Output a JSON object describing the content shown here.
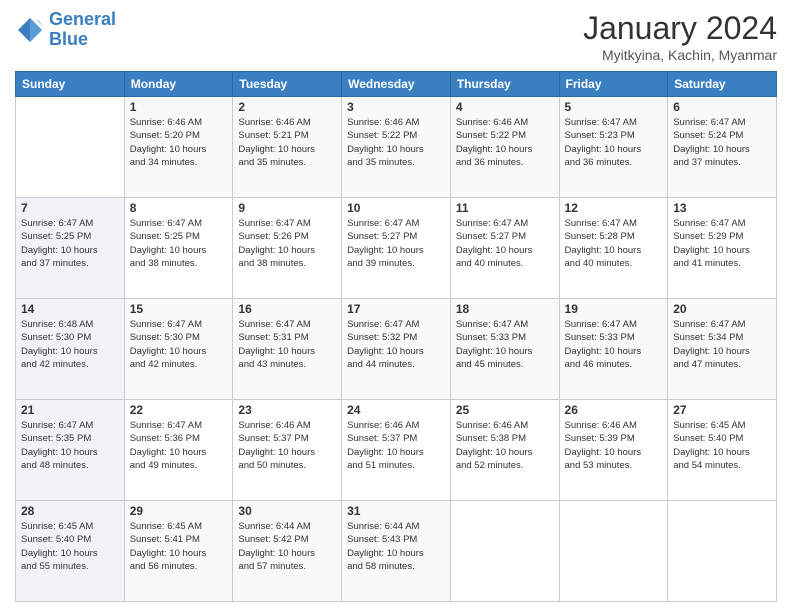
{
  "logo": {
    "line1": "General",
    "line2": "Blue"
  },
  "title": "January 2024",
  "subtitle": "Myitkyina, Kachin, Myanmar",
  "weekdays": [
    "Sunday",
    "Monday",
    "Tuesday",
    "Wednesday",
    "Thursday",
    "Friday",
    "Saturday"
  ],
  "weeks": [
    [
      {
        "day": "",
        "info": ""
      },
      {
        "day": "1",
        "info": "Sunrise: 6:46 AM\nSunset: 5:20 PM\nDaylight: 10 hours\nand 34 minutes."
      },
      {
        "day": "2",
        "info": "Sunrise: 6:46 AM\nSunset: 5:21 PM\nDaylight: 10 hours\nand 35 minutes."
      },
      {
        "day": "3",
        "info": "Sunrise: 6:46 AM\nSunset: 5:22 PM\nDaylight: 10 hours\nand 35 minutes."
      },
      {
        "day": "4",
        "info": "Sunrise: 6:46 AM\nSunset: 5:22 PM\nDaylight: 10 hours\nand 36 minutes."
      },
      {
        "day": "5",
        "info": "Sunrise: 6:47 AM\nSunset: 5:23 PM\nDaylight: 10 hours\nand 36 minutes."
      },
      {
        "day": "6",
        "info": "Sunrise: 6:47 AM\nSunset: 5:24 PM\nDaylight: 10 hours\nand 37 minutes."
      }
    ],
    [
      {
        "day": "7",
        "info": "Sunrise: 6:47 AM\nSunset: 5:25 PM\nDaylight: 10 hours\nand 37 minutes."
      },
      {
        "day": "8",
        "info": "Sunrise: 6:47 AM\nSunset: 5:25 PM\nDaylight: 10 hours\nand 38 minutes."
      },
      {
        "day": "9",
        "info": "Sunrise: 6:47 AM\nSunset: 5:26 PM\nDaylight: 10 hours\nand 38 minutes."
      },
      {
        "day": "10",
        "info": "Sunrise: 6:47 AM\nSunset: 5:27 PM\nDaylight: 10 hours\nand 39 minutes."
      },
      {
        "day": "11",
        "info": "Sunrise: 6:47 AM\nSunset: 5:27 PM\nDaylight: 10 hours\nand 40 minutes."
      },
      {
        "day": "12",
        "info": "Sunrise: 6:47 AM\nSunset: 5:28 PM\nDaylight: 10 hours\nand 40 minutes."
      },
      {
        "day": "13",
        "info": "Sunrise: 6:47 AM\nSunset: 5:29 PM\nDaylight: 10 hours\nand 41 minutes."
      }
    ],
    [
      {
        "day": "14",
        "info": "Sunrise: 6:48 AM\nSunset: 5:30 PM\nDaylight: 10 hours\nand 42 minutes."
      },
      {
        "day": "15",
        "info": "Sunrise: 6:47 AM\nSunset: 5:30 PM\nDaylight: 10 hours\nand 42 minutes."
      },
      {
        "day": "16",
        "info": "Sunrise: 6:47 AM\nSunset: 5:31 PM\nDaylight: 10 hours\nand 43 minutes."
      },
      {
        "day": "17",
        "info": "Sunrise: 6:47 AM\nSunset: 5:32 PM\nDaylight: 10 hours\nand 44 minutes."
      },
      {
        "day": "18",
        "info": "Sunrise: 6:47 AM\nSunset: 5:33 PM\nDaylight: 10 hours\nand 45 minutes."
      },
      {
        "day": "19",
        "info": "Sunrise: 6:47 AM\nSunset: 5:33 PM\nDaylight: 10 hours\nand 46 minutes."
      },
      {
        "day": "20",
        "info": "Sunrise: 6:47 AM\nSunset: 5:34 PM\nDaylight: 10 hours\nand 47 minutes."
      }
    ],
    [
      {
        "day": "21",
        "info": "Sunrise: 6:47 AM\nSunset: 5:35 PM\nDaylight: 10 hours\nand 48 minutes."
      },
      {
        "day": "22",
        "info": "Sunrise: 6:47 AM\nSunset: 5:36 PM\nDaylight: 10 hours\nand 49 minutes."
      },
      {
        "day": "23",
        "info": "Sunrise: 6:46 AM\nSunset: 5:37 PM\nDaylight: 10 hours\nand 50 minutes."
      },
      {
        "day": "24",
        "info": "Sunrise: 6:46 AM\nSunset: 5:37 PM\nDaylight: 10 hours\nand 51 minutes."
      },
      {
        "day": "25",
        "info": "Sunrise: 6:46 AM\nSunset: 5:38 PM\nDaylight: 10 hours\nand 52 minutes."
      },
      {
        "day": "26",
        "info": "Sunrise: 6:46 AM\nSunset: 5:39 PM\nDaylight: 10 hours\nand 53 minutes."
      },
      {
        "day": "27",
        "info": "Sunrise: 6:45 AM\nSunset: 5:40 PM\nDaylight: 10 hours\nand 54 minutes."
      }
    ],
    [
      {
        "day": "28",
        "info": "Sunrise: 6:45 AM\nSunset: 5:40 PM\nDaylight: 10 hours\nand 55 minutes."
      },
      {
        "day": "29",
        "info": "Sunrise: 6:45 AM\nSunset: 5:41 PM\nDaylight: 10 hours\nand 56 minutes."
      },
      {
        "day": "30",
        "info": "Sunrise: 6:44 AM\nSunset: 5:42 PM\nDaylight: 10 hours\nand 57 minutes."
      },
      {
        "day": "31",
        "info": "Sunrise: 6:44 AM\nSunset: 5:43 PM\nDaylight: 10 hours\nand 58 minutes."
      },
      {
        "day": "",
        "info": ""
      },
      {
        "day": "",
        "info": ""
      },
      {
        "day": "",
        "info": ""
      }
    ]
  ]
}
